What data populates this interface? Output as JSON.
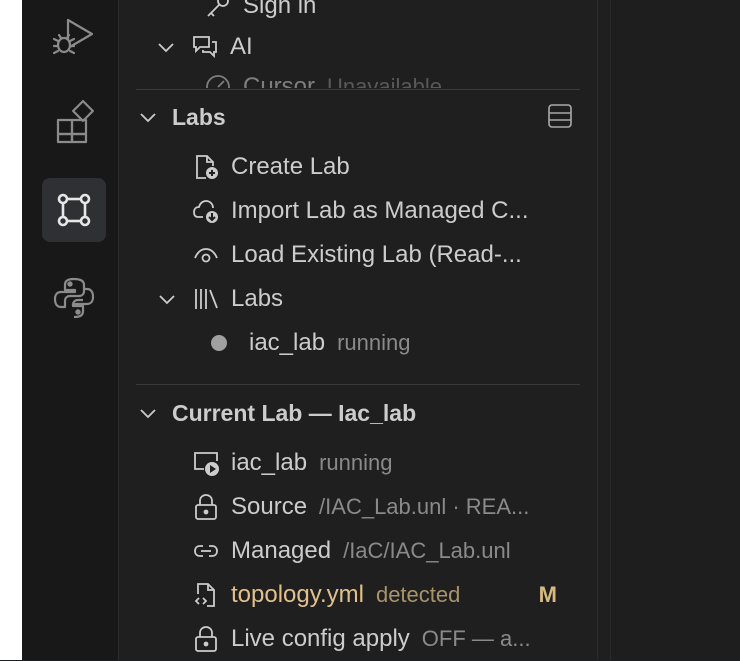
{
  "top_tree": {
    "sign_in_label": "Sign in",
    "ai_label": "AI",
    "cursor_label": "Cursor",
    "cursor_desc": "Unavailable"
  },
  "labs_section": {
    "title": "Labs",
    "items": [
      {
        "label": "Create Lab"
      },
      {
        "label": "Import Lab as Managed C..."
      },
      {
        "label": "Load Existing Lab (Read-..."
      }
    ],
    "labs_group": {
      "label": "Labs",
      "children": [
        {
          "label": "iac_lab",
          "desc": "running"
        }
      ]
    }
  },
  "current_lab_section": {
    "title": "Current Lab — Iac_lab",
    "items": [
      {
        "label": "iac_lab",
        "desc": "running"
      },
      {
        "label": "Source",
        "desc": "/IAC_Lab.unl · REA..."
      },
      {
        "label": "Managed",
        "desc": "/IaC/IAC_Lab.unl"
      },
      {
        "label": "topology.yml",
        "desc": "detected",
        "badge": "M"
      },
      {
        "label": "Live config apply",
        "desc": "OFF — a..."
      }
    ]
  },
  "colors": {
    "background": "#1f1f1f",
    "text": "#cccccc",
    "muted": "#8a8a8a",
    "modified": "#e2c08d",
    "active_bg": "#2e3033"
  },
  "icons": [
    "run-debug-icon",
    "extensions-icon",
    "containerlab-icon",
    "python-icon",
    "server-stack-icon"
  ]
}
